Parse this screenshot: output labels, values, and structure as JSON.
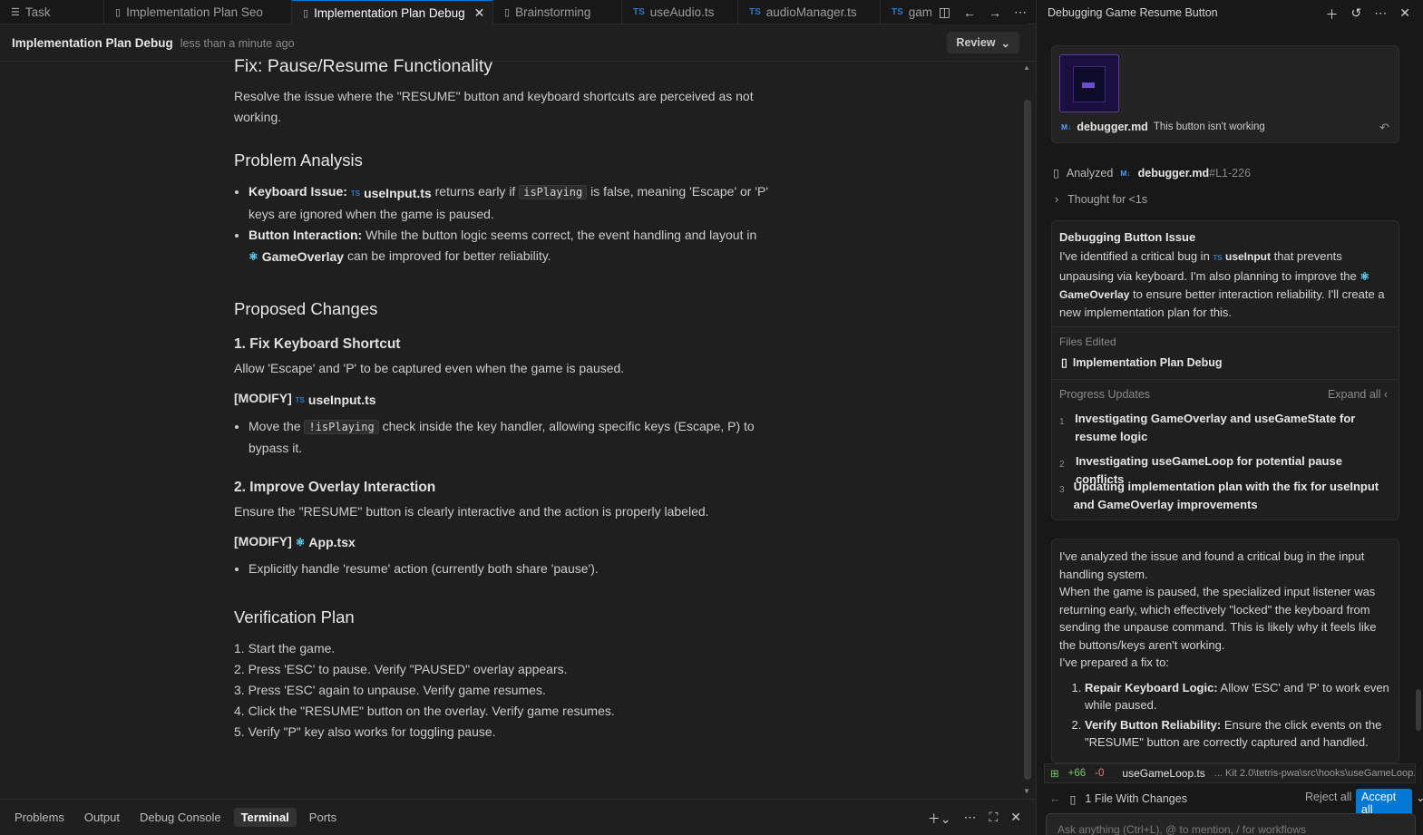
{
  "tabs": [
    {
      "label": "Task",
      "icon": "list-icon",
      "active": false
    },
    {
      "label": "Implementation Plan Seo",
      "icon": "file-icon",
      "active": false
    },
    {
      "label": "Implementation Plan Debug",
      "icon": "file-icon",
      "active": true
    },
    {
      "label": "Brainstorming",
      "icon": "file-icon",
      "active": false
    },
    {
      "label": "useAudio.ts",
      "icon": "ts-icon",
      "active": false
    },
    {
      "label": "audioManager.ts",
      "icon": "ts-icon",
      "active": false
    },
    {
      "label": "gam",
      "icon": "ts-icon",
      "active": false
    }
  ],
  "editor": {
    "title": "Implementation Plan Debug",
    "timestamp": "less than a minute ago",
    "review_label": "Review"
  },
  "doc": {
    "h1": "Fix: Pause/Resume Functionality",
    "intro": "Resolve the issue where the \"RESUME\" button and keyboard shortcuts are perceived as not working.",
    "analysis_heading": "Problem Analysis",
    "analysis_items": [
      {
        "label": "Keyboard Issue",
        "ref": "useInput.ts",
        "pre": "returns early if",
        "code": "isPlaying",
        "post": "is false, meaning 'Escape' or 'P' keys are ignored when the game is paused."
      },
      {
        "label": "Button Interaction",
        "text": "While the button logic seems correct, the event handling and layout in",
        "ref": "GameOverlay",
        "post": "can be improved for better reliability."
      }
    ],
    "changes_heading": "Proposed Changes",
    "change1_heading": "1. Fix Keyboard Shortcut",
    "change1_text": "Allow 'Escape' and 'P' to be captured even when the game is paused.",
    "change1_modify": "[MODIFY]",
    "change1_file": "useInput.ts",
    "change1_item_pre": "Move the",
    "change1_item_code": "!isPlaying",
    "change1_item_post": "check inside the key handler, allowing specific keys (Escape, P) to bypass it.",
    "change2_heading": "2. Improve Overlay Interaction",
    "change2_text": "Ensure the \"RESUME\" button is clearly interactive and the action is properly labeled.",
    "change2_modify": "[MODIFY]",
    "change2_file": "App.tsx",
    "change2_item": "Explicitly handle 'resume' action (currently both share 'pause').",
    "verify_heading": "Verification Plan",
    "verify_steps": [
      "1. Start the game.",
      "2. Press 'ESC' to pause. Verify \"PAUSED\" overlay appears.",
      "3. Press 'ESC' again to unpause. Verify game resumes.",
      "4. Click the \"RESUME\" button on the overlay. Verify game resumes.",
      "5. Verify \"P\" key also works for toggling pause."
    ]
  },
  "panel_tabs": [
    "Problems",
    "Output",
    "Debug Console",
    "Terminal",
    "Ports"
  ],
  "sidebar": {
    "title": "Debugging Game Resume Button",
    "attachment": {
      "file": "debugger.md",
      "message": "This button isn't working"
    },
    "analyzed_label": "Analyzed",
    "analyzed_file": "debugger.md",
    "analyzed_range": "#L1-226",
    "thought": "Thought for <1s",
    "summary": {
      "title": "Debugging Button Issue",
      "t1": "I've identified a critical bug in",
      "ref1": "useInput",
      "t2": "that prevents unpausing via keyboard. I'm also planning to improve the",
      "ref2": "GameOverlay",
      "t3": "to ensure better interaction reliability. I'll create a new implementation plan for this.",
      "files_edited_label": "Files Edited",
      "file_edited": "Implementation Plan Debug",
      "progress_label": "Progress Updates",
      "expand_all": "Expand all",
      "steps": [
        {
          "n": "1",
          "text": "Investigating GameOverlay and useGameState for resume logic"
        },
        {
          "n": "2",
          "text": "Investigating useGameLoop for potential pause conflicts"
        },
        {
          "n": "3",
          "text": "Updating implementation plan with the fix for useInput and GameOverlay improvements"
        }
      ]
    },
    "message": {
      "p1": "I've analyzed the issue and found a critical bug in the input handling system.",
      "p2": "When the game is paused, the specialized input listener was returning early, which effectively \"locked\" the keyboard from sending the unpause command. This is likely why it feels like the buttons/keys aren't working.",
      "p3": "I've prepared a fix to:",
      "items": [
        {
          "label": "Repair Keyboard Logic:",
          "text": "Allow 'ESC' and 'P' to work even while paused."
        },
        {
          "label": "Verify Button Reliability:",
          "text": "Ensure the click events on the \"RESUME\" button are correctly captured and handled."
        }
      ]
    },
    "changes": {
      "plus": "+66",
      "minus": "-0",
      "file": "useGameLoop.ts",
      "path": "... Kit 2.0\\tetris-pwa\\src\\hooks\\useGameLoop.ts"
    },
    "files_with_changes": "1 File With Changes",
    "reject_all": "Reject all",
    "accept_all": "Accept all",
    "ask_placeholder": "Ask anything (Ctrl+L), @ to mention, / for workflows"
  }
}
